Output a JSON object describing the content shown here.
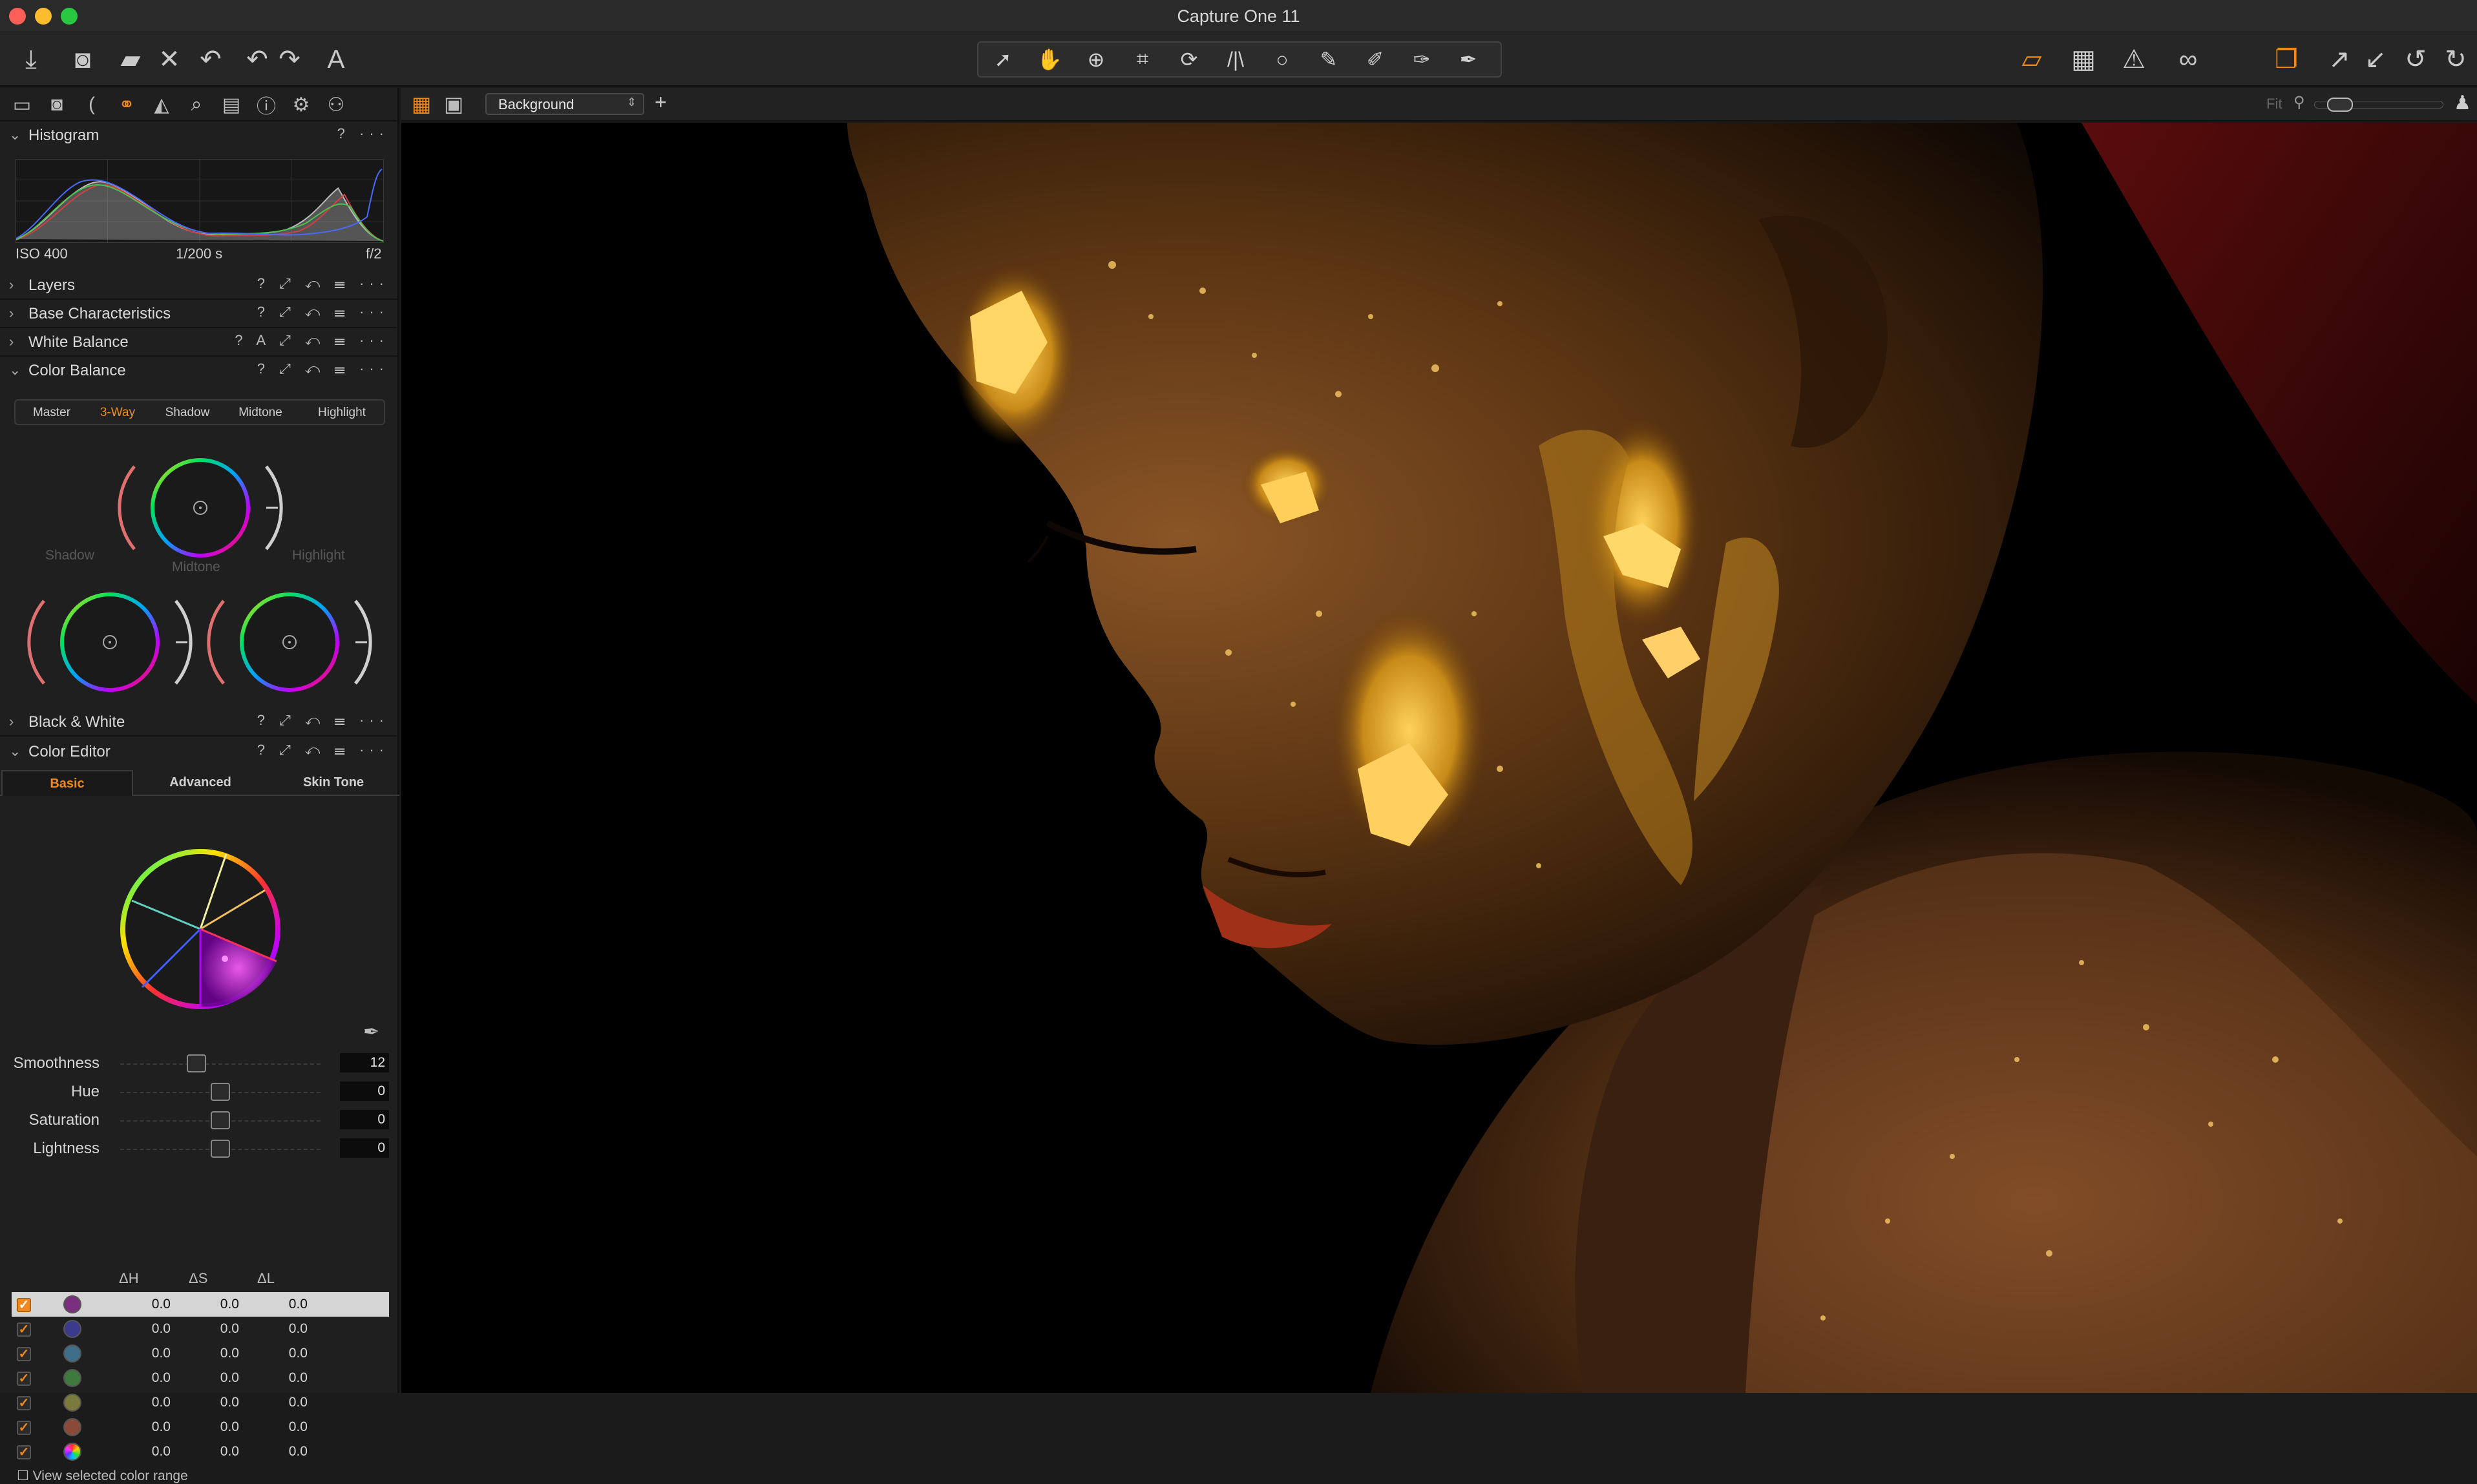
{
  "window": {
    "title": "Capture One 11"
  },
  "toolbar": {
    "left_icons": [
      "import-icon",
      "camera-icon",
      "move-folder-icon",
      "delete-icon",
      "undo-icon",
      "undo-back-icon",
      "redo-icon",
      "text-icon"
    ],
    "cursor_tools": [
      "pointer-icon",
      "pan-hand-icon",
      "zoom-icon",
      "crop-icon",
      "rotate-icon",
      "keystone-icon",
      "spot-removal-icon",
      "brush-icon",
      "erase-icon",
      "gradient-icon",
      "picker-icon"
    ],
    "right_icons": [
      "edit-icon",
      "grid-icon",
      "warning-icon",
      "glasses-icon",
      "browser-icon",
      "copy-adjustments-icon",
      "apply-adjustments-icon",
      "reset-icon",
      "redo-all-icon"
    ]
  },
  "tool_tabs": [
    "library-icon",
    "capture-icon",
    "lens-icon",
    "color-icon",
    "exposure-icon",
    "details-icon",
    "metadata-icon",
    "info-icon",
    "settings-icon",
    "batch-icon"
  ],
  "histogram": {
    "label": "Histogram",
    "iso": "ISO 400",
    "shutter": "1/200 s",
    "aperture": "f/2"
  },
  "panels": {
    "layers": "Layers",
    "base": "Base Characteristics",
    "white_balance": "White Balance",
    "white_balance_auto": "A",
    "color_balance": "Color Balance",
    "black_white": "Black & White",
    "color_editor": "Color Editor",
    "help": "?"
  },
  "color_balance": {
    "modes": [
      "Master",
      "3-Way",
      "Shadow",
      "Midtone",
      "Highlight"
    ],
    "active_mode": "3-Way",
    "wheels": {
      "shadow": "Shadow",
      "midtone": "Midtone",
      "highlight": "Highlight"
    }
  },
  "color_editor": {
    "tabs": [
      "Basic",
      "Advanced",
      "Skin Tone"
    ],
    "active_tab": "Basic",
    "sliders": [
      {
        "label": "Smoothness",
        "value": "12",
        "pos": 0.38
      },
      {
        "label": "Hue",
        "value": "0",
        "pos": 0.5
      },
      {
        "label": "Saturation",
        "value": "0",
        "pos": 0.5
      },
      {
        "label": "Lightness",
        "value": "0",
        "pos": 0.5
      }
    ],
    "table_headers": {
      "dh": "ΔH",
      "ds": "ΔS",
      "dl": "ΔL"
    },
    "rows": [
      {
        "color": "#7a2f7e",
        "dh": "0.0",
        "ds": "0.0",
        "dl": "0.0"
      },
      {
        "color": "#3b3a8c",
        "dh": "0.0",
        "ds": "0.0",
        "dl": "0.0"
      },
      {
        "color": "#3f6e8a",
        "dh": "0.0",
        "ds": "0.0",
        "dl": "0.0"
      },
      {
        "color": "#3e7a3e",
        "dh": "0.0",
        "ds": "0.0",
        "dl": "0.0"
      },
      {
        "color": "#7a7a3c",
        "dh": "0.0",
        "ds": "0.0",
        "dl": "0.0"
      },
      {
        "color": "#8a4a3a",
        "dh": "0.0",
        "ds": "0.0",
        "dl": "0.0"
      },
      {
        "color": "rainbow",
        "dh": "0.0",
        "ds": "0.0",
        "dl": "0.0"
      }
    ],
    "footnote": "View selected color range"
  },
  "viewer": {
    "layer_select": "Background",
    "zoom_label": "Fit",
    "zoom_level": 0.12
  },
  "colors": {
    "accent": "#f08a1c",
    "panel": "#1f1f1f",
    "viewer": "#000000"
  }
}
